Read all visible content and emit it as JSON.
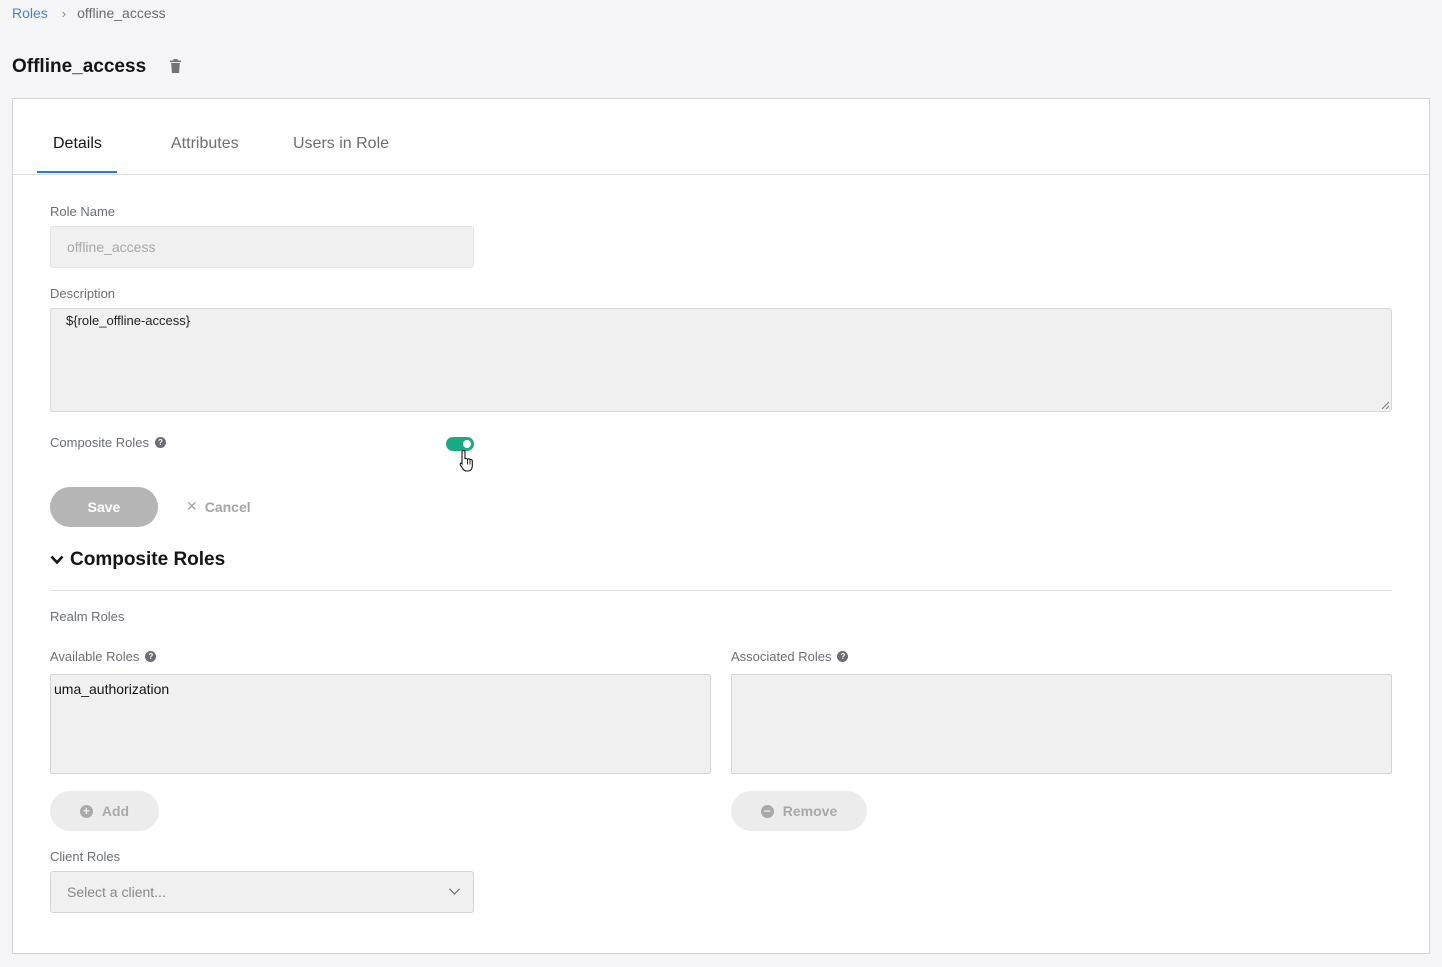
{
  "breadcrumb": {
    "parent": "Roles",
    "current": "offline_access"
  },
  "page": {
    "title": "Offline_access",
    "delete_icon": "trash-icon"
  },
  "tabs": [
    {
      "label": "Details",
      "active": true
    },
    {
      "label": "Attributes",
      "active": false
    },
    {
      "label": "Users in Role",
      "active": false
    }
  ],
  "form": {
    "role_name": {
      "label": "Role Name",
      "value": "offline_access"
    },
    "description": {
      "label": "Description",
      "value": "${role_offline-access}"
    },
    "composite_roles": {
      "label": "Composite Roles",
      "enabled": true,
      "on_color": "#1aaa82"
    },
    "save_label": "Save",
    "cancel_label": "Cancel"
  },
  "composite": {
    "heading": "Composite Roles",
    "realm_roles_label": "Realm Roles",
    "available": {
      "label": "Available Roles",
      "items": [
        "uma_authorization"
      ]
    },
    "associated": {
      "label": "Associated Roles",
      "items": []
    },
    "add_label": "Add",
    "remove_label": "Remove",
    "client_roles": {
      "label": "Client Roles",
      "placeholder": "Select a client..."
    }
  },
  "colors": {
    "accent": "#2b7cd3",
    "link": "#4a84d4",
    "toggle_on": "#1aaa82"
  }
}
